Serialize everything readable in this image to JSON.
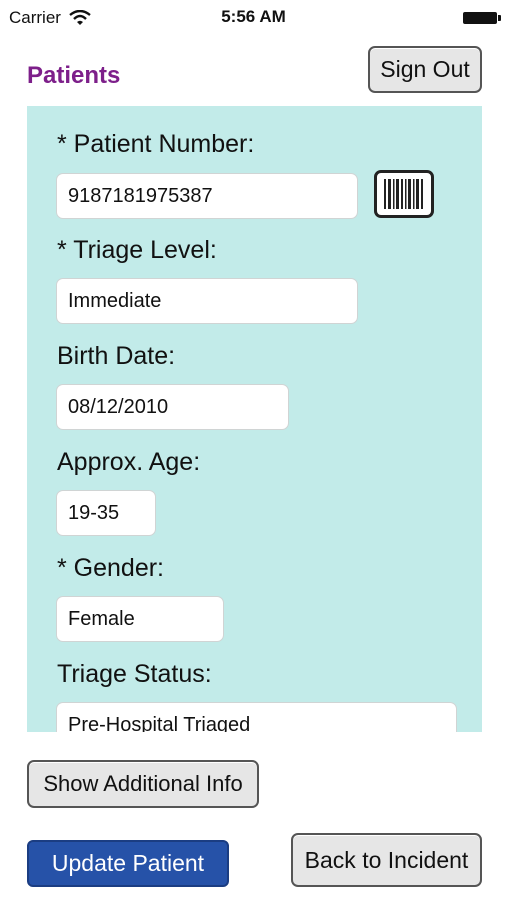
{
  "status_bar": {
    "carrier": "Carrier",
    "time": "5:56 AM"
  },
  "header": {
    "title": "Patients",
    "sign_out_label": "Sign Out"
  },
  "form": {
    "patient_number": {
      "label": "* Patient Number:",
      "value": "9187181975387"
    },
    "triage_level": {
      "label": "* Triage Level:",
      "value": "Immediate"
    },
    "birth_date": {
      "label": "Birth Date:",
      "value": "08/12/2010"
    },
    "approx_age": {
      "label": "Approx. Age:",
      "value": "19-35"
    },
    "gender": {
      "label": "* Gender:",
      "value": "Female"
    },
    "triage_status": {
      "label": "Triage Status:",
      "value": "Pre-Hospital Triaged"
    }
  },
  "actions": {
    "show_additional_info_label": "Show Additional Info",
    "update_patient_label": "Update Patient",
    "back_to_incident_label": "Back to Incident"
  },
  "colors": {
    "title": "#7d1f8a",
    "panel_bg": "#c2ebe9",
    "primary_button": "#2652a8"
  },
  "icons": {
    "barcode": "barcode-icon",
    "wifi": "wifi-icon",
    "battery": "battery-icon"
  }
}
